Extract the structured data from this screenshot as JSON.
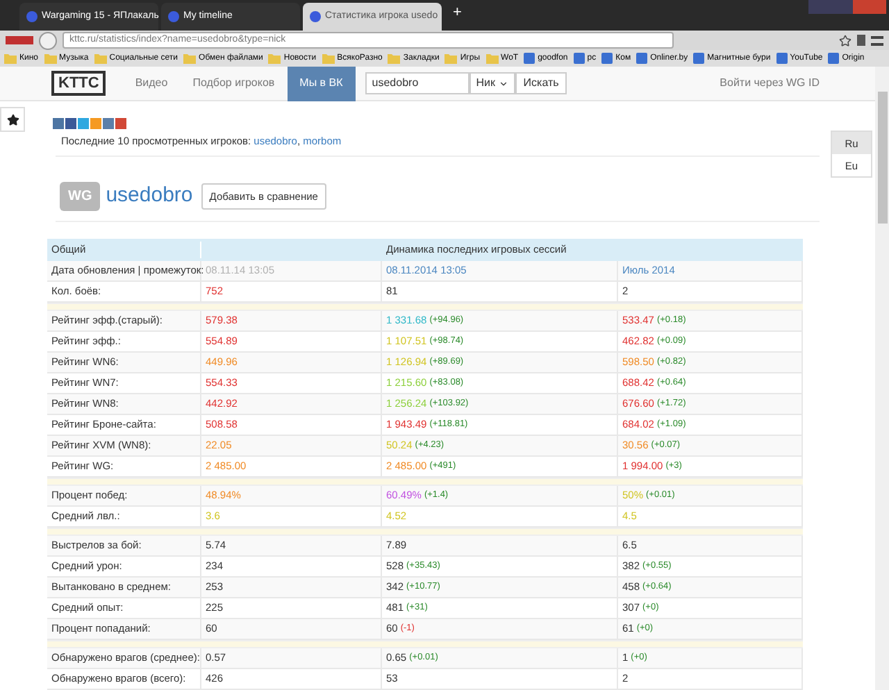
{
  "browser": {
    "tabs": [
      {
        "title": "Wargaming 15 - ЯПлакаль",
        "selected": false
      },
      {
        "title": "My timeline",
        "selected": false
      },
      {
        "title": "Статистика игрока usedo",
        "selected": true
      }
    ],
    "new_tab": "+",
    "url": "kttc.ru/statistics/index?name=usedobro&type=nick",
    "bookmarks": [
      {
        "label": "Кино",
        "kind": "folder"
      },
      {
        "label": "Музыка",
        "kind": "folder"
      },
      {
        "label": "Социальные сети",
        "kind": "folder"
      },
      {
        "label": "Обмен файлами",
        "kind": "folder"
      },
      {
        "label": "Новости",
        "kind": "folder"
      },
      {
        "label": "ВсякоРазно",
        "kind": "folder"
      },
      {
        "label": "Закладки",
        "kind": "folder"
      },
      {
        "label": "Игры",
        "kind": "folder"
      },
      {
        "label": "WoT",
        "kind": "folder"
      },
      {
        "label": "goodfon",
        "kind": "site"
      },
      {
        "label": "pc",
        "kind": "site"
      },
      {
        "label": "Ком",
        "kind": "site"
      },
      {
        "label": "Onliner.by",
        "kind": "site"
      },
      {
        "label": "Магнитные бури",
        "kind": "site"
      },
      {
        "label": "YouTube",
        "kind": "site"
      },
      {
        "label": "Origin",
        "kind": "site"
      }
    ]
  },
  "navbar": {
    "logo": "KTTC",
    "links": [
      {
        "label": "Видео",
        "selected": false
      },
      {
        "label": "Подбор игроков",
        "selected": false
      },
      {
        "label": "Мы в ВК",
        "selected": true
      }
    ],
    "search": {
      "value": "usedobro",
      "type": "Ник",
      "button": "Искать"
    },
    "login": "Войти через WG ID"
  },
  "recent": {
    "label": "Последние 10 просмотренных игроков:",
    "separator": ",",
    "players": [
      "usedobro",
      "morbom"
    ]
  },
  "languages": [
    {
      "label": "Ru",
      "selected": true
    },
    {
      "label": "Eu",
      "selected": false
    }
  ],
  "player": {
    "badge": "WG",
    "name": "usedobro",
    "compare_button": "Добавить в сравнение"
  },
  "table": {
    "header": [
      "Общий",
      "Динамика последних игровых сессий"
    ],
    "groups": [
      {
        "rows": [
          {
            "label": "Дата обновления | промежуток:",
            "cells": [
              {
                "text": "08.11.14 13:05",
                "color": "#b0b0b0"
              },
              {
                "text": "08.11.2014 13:05",
                "color": "#4a86c0"
              },
              {
                "text": "Июль 2014",
                "color": "#4a86c0"
              }
            ]
          },
          {
            "label": "Кол. боёв:",
            "cells": [
              {
                "text": "752",
                "color": "#e0302f"
              },
              {
                "text": "81",
                "color": "#333333"
              },
              {
                "text": "2",
                "color": "#333333"
              }
            ]
          }
        ]
      },
      {
        "rows": [
          {
            "label": "Рейтинг эфф.(старый):",
            "cells": [
              {
                "text": "579.38",
                "color": "#e0302f"
              },
              {
                "text": "1 331.68",
                "color": "#2fb8c8",
                "delta": {
                  "text": "(+94.96)",
                  "color": "#2a8a2a"
                }
              },
              {
                "text": "533.47",
                "color": "#e0302f",
                "delta": {
                  "text": "(+0.18)",
                  "color": "#2a8a2a"
                }
              }
            ]
          },
          {
            "label": "Рейтинг эфф.:",
            "cells": [
              {
                "text": "554.89",
                "color": "#e0302f"
              },
              {
                "text": "1 107.51",
                "color": "#d0c420",
                "delta": {
                  "text": "(+98.74)",
                  "color": "#2a8a2a"
                }
              },
              {
                "text": "462.82",
                "color": "#e0302f",
                "delta": {
                  "text": "(+0.09)",
                  "color": "#2a8a2a"
                }
              }
            ]
          },
          {
            "label": "Рейтинг WN6:",
            "cells": [
              {
                "text": "449.96",
                "color": "#f08a24"
              },
              {
                "text": "1 126.94",
                "color": "#d0c420",
                "delta": {
                  "text": "(+89.69)",
                  "color": "#2a8a2a"
                }
              },
              {
                "text": "598.50",
                "color": "#f08a24",
                "delta": {
                  "text": "(+0.82)",
                  "color": "#2a8a2a"
                }
              }
            ]
          },
          {
            "label": "Рейтинг WN7:",
            "cells": [
              {
                "text": "554.33",
                "color": "#e0302f"
              },
              {
                "text": "1 215.60",
                "color": "#8ccf3a",
                "delta": {
                  "text": "(+83.08)",
                  "color": "#2a8a2a"
                }
              },
              {
                "text": "688.42",
                "color": "#e0302f",
                "delta": {
                  "text": "(+0.64)",
                  "color": "#2a8a2a"
                }
              }
            ]
          },
          {
            "label": "Рейтинг WN8:",
            "cells": [
              {
                "text": "442.92",
                "color": "#e0302f"
              },
              {
                "text": "1 256.24",
                "color": "#8ccf3a",
                "delta": {
                  "text": "(+103.92)",
                  "color": "#2a8a2a"
                }
              },
              {
                "text": "676.60",
                "color": "#e0302f",
                "delta": {
                  "text": "(+1.72)",
                  "color": "#2a8a2a"
                }
              }
            ]
          },
          {
            "label": "Рейтинг Броне-сайта:",
            "cells": [
              {
                "text": "508.58",
                "color": "#e0302f"
              },
              {
                "text": "1 943.49",
                "color": "#e0302f",
                "delta": {
                  "text": "(+118.81)",
                  "color": "#2a8a2a"
                }
              },
              {
                "text": "684.02",
                "color": "#e0302f",
                "delta": {
                  "text": "(+1.09)",
                  "color": "#2a8a2a"
                }
              }
            ]
          },
          {
            "label": "Рейтинг XVM (WN8):",
            "cells": [
              {
                "text": "22.05",
                "color": "#f08a24"
              },
              {
                "text": "50.24",
                "color": "#d0c420",
                "delta": {
                  "text": "(+4.23)",
                  "color": "#2a8a2a"
                }
              },
              {
                "text": "30.56",
                "color": "#f08a24",
                "delta": {
                  "text": "(+0.07)",
                  "color": "#2a8a2a"
                }
              }
            ]
          },
          {
            "label": "Рейтинг WG:",
            "cells": [
              {
                "text": "2 485.00",
                "color": "#f08a24"
              },
              {
                "text": "2 485.00",
                "color": "#f08a24",
                "delta": {
                  "text": "(+491)",
                  "color": "#2a8a2a"
                }
              },
              {
                "text": "1 994.00",
                "color": "#e0302f",
                "delta": {
                  "text": "(+3)",
                  "color": "#2a8a2a"
                }
              }
            ]
          }
        ]
      },
      {
        "rows": [
          {
            "label": "Процент побед:",
            "cells": [
              {
                "text": "48.94%",
                "color": "#f08a24"
              },
              {
                "text": "60.49%",
                "color": "#c050e0",
                "delta": {
                  "text": "(+1.4)",
                  "color": "#2a8a2a"
                }
              },
              {
                "text": "50%",
                "color": "#d0c420",
                "delta": {
                  "text": "(+0.01)",
                  "color": "#2a8a2a"
                }
              }
            ]
          },
          {
            "label": "Средний лвл.:",
            "cells": [
              {
                "text": "3.6",
                "color": "#d0c420"
              },
              {
                "text": "4.52",
                "color": "#d0c420"
              },
              {
                "text": "4.5",
                "color": "#d0c420"
              }
            ]
          }
        ]
      },
      {
        "rows": [
          {
            "label": "Выстрелов за бой:",
            "cells": [
              {
                "text": "5.74",
                "color": "#333333"
              },
              {
                "text": "7.89",
                "color": "#333333"
              },
              {
                "text": "6.5",
                "color": "#333333"
              }
            ]
          },
          {
            "label": "Средний урон:",
            "cells": [
              {
                "text": "234",
                "color": "#333333"
              },
              {
                "text": "528",
                "color": "#333333",
                "delta": {
                  "text": "(+35.43)",
                  "color": "#2a8a2a"
                }
              },
              {
                "text": "382",
                "color": "#333333",
                "delta": {
                  "text": "(+0.55)",
                  "color": "#2a8a2a"
                }
              }
            ]
          },
          {
            "label": "Вытанковано в среднем:",
            "cells": [
              {
                "text": "253",
                "color": "#333333"
              },
              {
                "text": "342",
                "color": "#333333",
                "delta": {
                  "text": "(+10.77)",
                  "color": "#2a8a2a"
                }
              },
              {
                "text": "458",
                "color": "#333333",
                "delta": {
                  "text": "(+0.64)",
                  "color": "#2a8a2a"
                }
              }
            ]
          },
          {
            "label": "Средний опыт:",
            "cells": [
              {
                "text": "225",
                "color": "#333333"
              },
              {
                "text": "481",
                "color": "#333333",
                "delta": {
                  "text": "(+31)",
                  "color": "#2a8a2a"
                }
              },
              {
                "text": "307",
                "color": "#333333",
                "delta": {
                  "text": "(+0)",
                  "color": "#2a8a2a"
                }
              }
            ]
          },
          {
            "label": "Процент попаданий:",
            "cells": [
              {
                "text": "60",
                "color": "#333333"
              },
              {
                "text": "60",
                "color": "#333333",
                "delta": {
                  "text": "(-1)",
                  "color": "#e0302f"
                }
              },
              {
                "text": "61",
                "color": "#333333",
                "delta": {
                  "text": "(+0)",
                  "color": "#2a8a2a"
                }
              }
            ]
          }
        ]
      },
      {
        "rows": [
          {
            "label": "Обнаружено врагов (среднее):",
            "cells": [
              {
                "text": "0.57",
                "color": "#333333"
              },
              {
                "text": "0.65",
                "color": "#333333",
                "delta": {
                  "text": "(+0.01)",
                  "color": "#2a8a2a"
                }
              },
              {
                "text": "1",
                "color": "#333333",
                "delta": {
                  "text": "(+0)",
                  "color": "#2a8a2a"
                }
              }
            ]
          },
          {
            "label": "Обнаружено врагов (всего):",
            "cells": [
              {
                "text": "426",
                "color": "#333333"
              },
              {
                "text": "53",
                "color": "#333333"
              },
              {
                "text": "2",
                "color": "#333333"
              }
            ]
          }
        ]
      }
    ]
  }
}
